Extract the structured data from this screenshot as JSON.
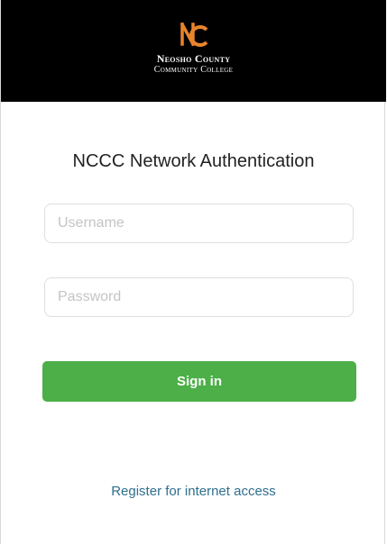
{
  "header": {
    "logo_icon": "college-monogram-icon",
    "logo_color": "#e8842c",
    "college_name_line1": "Neosho County",
    "college_name_line2": "Community College"
  },
  "main": {
    "title": "NCCC Network Authentication",
    "username_placeholder": "Username",
    "password_placeholder": "Password",
    "signin_label": "Sign in",
    "register_link": "Register for internet access"
  },
  "colors": {
    "header_bg": "#000000",
    "button_bg": "#4caf48",
    "link": "#2e6f8f"
  }
}
